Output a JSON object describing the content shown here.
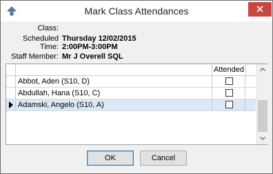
{
  "window": {
    "title": "Mark Class Attendances",
    "icons": {
      "app": "app-arrow-icon",
      "close": "close-icon"
    }
  },
  "info": {
    "class_label": "Class:",
    "class_value": "",
    "time_label": "Scheduled Time:",
    "time_date": "Thursday 12/02/2015",
    "time_range": "2:00PM-3:00PM",
    "staff_label": "Staff Member:",
    "staff_value": "Mr J Overell SQL"
  },
  "grid": {
    "columns": [
      "",
      "Attended"
    ],
    "rows": [
      {
        "name": "Abbot, Aden (S10, D)",
        "attended": false,
        "selected": false
      },
      {
        "name": "Abdullah, Hana (S10, C)",
        "attended": false,
        "selected": false
      },
      {
        "name": "Adamski, Angelo (S10, A)",
        "attended": false,
        "selected": true
      }
    ]
  },
  "buttons": {
    "ok": "OK",
    "cancel": "Cancel"
  },
  "colors": {
    "close_button": "#c7463e",
    "selected_row": "#dbe8f6"
  }
}
